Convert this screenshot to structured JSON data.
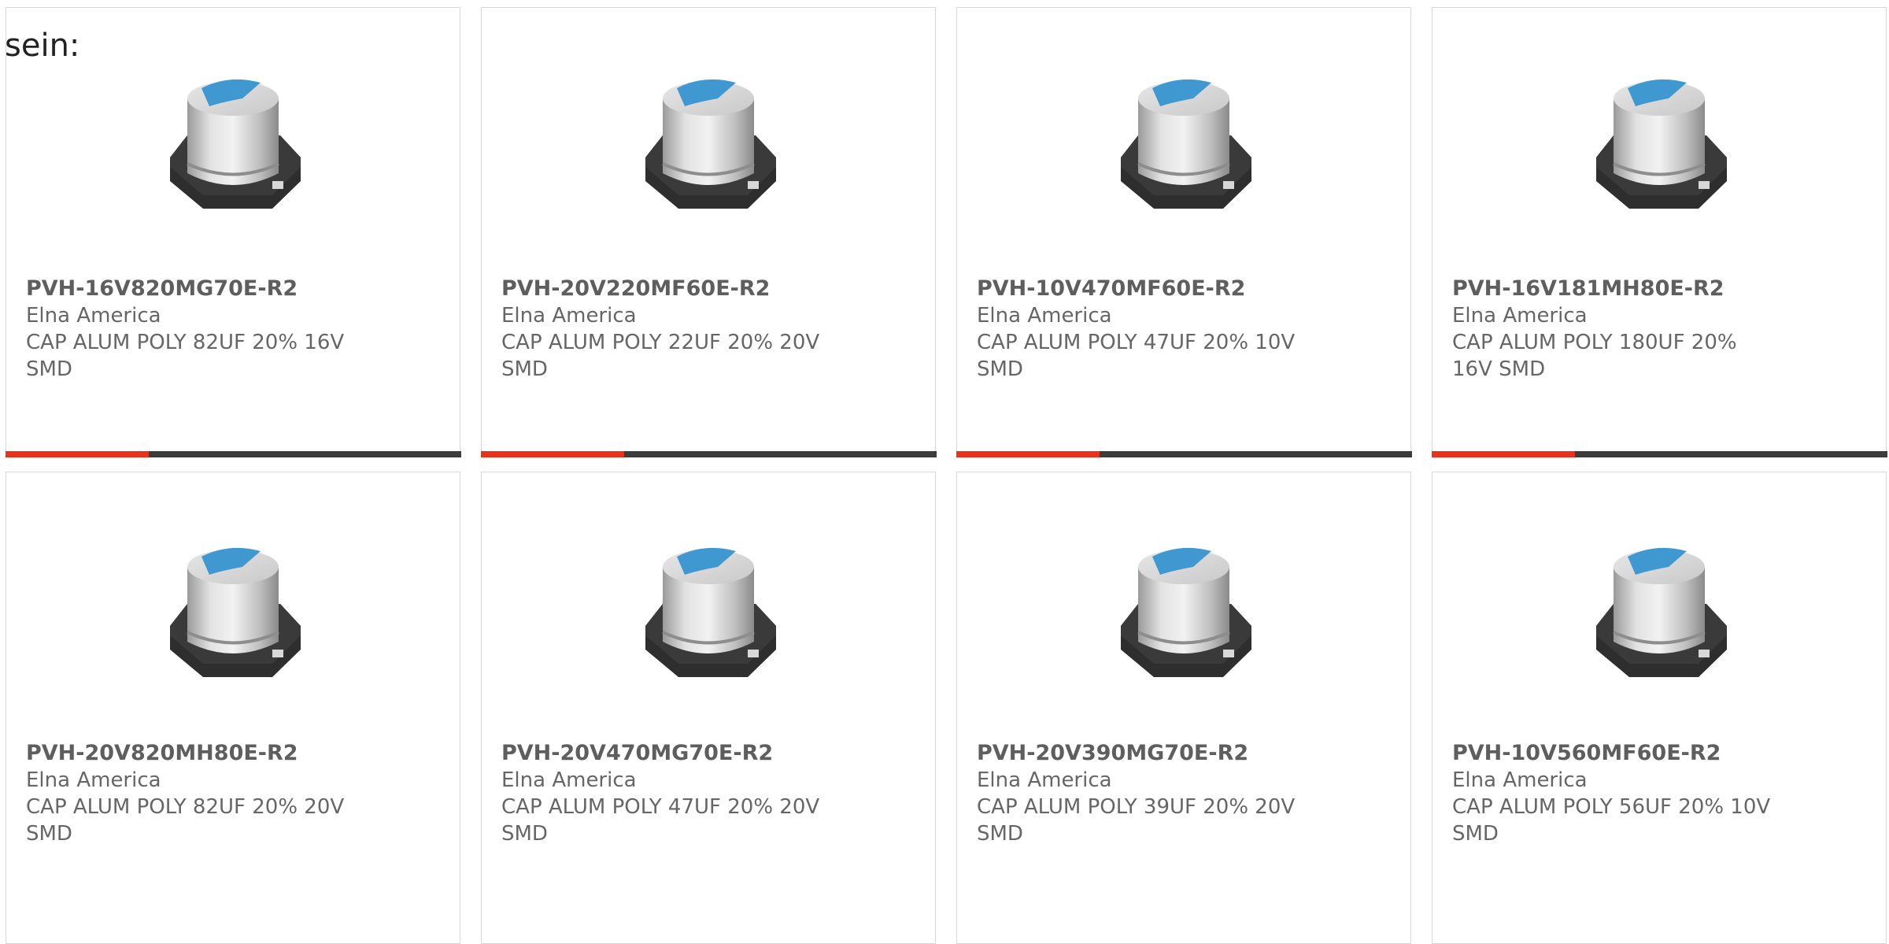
{
  "intro_text": "sein:",
  "colors": {
    "accent": "#e8321b",
    "bar": "#3c3c3c",
    "border": "#d8d8d8",
    "text": "#666666"
  },
  "products": [
    {
      "part": "PVH-16V820MG70E-R2",
      "manufacturer": "Elna America",
      "description": "CAP ALUM POLY 82UF 20% 16V SMD",
      "image_icon": "smd-capacitor-icon"
    },
    {
      "part": "PVH-20V220MF60E-R2",
      "manufacturer": "Elna America",
      "description": "CAP ALUM POLY 22UF 20% 20V SMD",
      "image_icon": "smd-capacitor-icon"
    },
    {
      "part": "PVH-10V470MF60E-R2",
      "manufacturer": "Elna America",
      "description": "CAP ALUM POLY 47UF 20% 10V SMD",
      "image_icon": "smd-capacitor-icon"
    },
    {
      "part": "PVH-16V181MH80E-R2",
      "manufacturer": "Elna America",
      "description": "CAP ALUM POLY 180UF 20% 16V SMD",
      "image_icon": "smd-capacitor-icon"
    },
    {
      "part": "PVH-20V820MH80E-R2",
      "manufacturer": "Elna America",
      "description": "CAP ALUM POLY 82UF 20% 20V SMD",
      "image_icon": "smd-capacitor-icon"
    },
    {
      "part": "PVH-20V470MG70E-R2",
      "manufacturer": "Elna America",
      "description": "CAP ALUM POLY 47UF 20% 20V SMD",
      "image_icon": "smd-capacitor-icon"
    },
    {
      "part": "PVH-20V390MG70E-R2",
      "manufacturer": "Elna America",
      "description": "CAP ALUM POLY 39UF 20% 20V SMD",
      "image_icon": "smd-capacitor-icon"
    },
    {
      "part": "PVH-10V560MF60E-R2",
      "manufacturer": "Elna America",
      "description": "CAP ALUM POLY 56UF 20% 10V SMD",
      "image_icon": "smd-capacitor-icon"
    }
  ]
}
